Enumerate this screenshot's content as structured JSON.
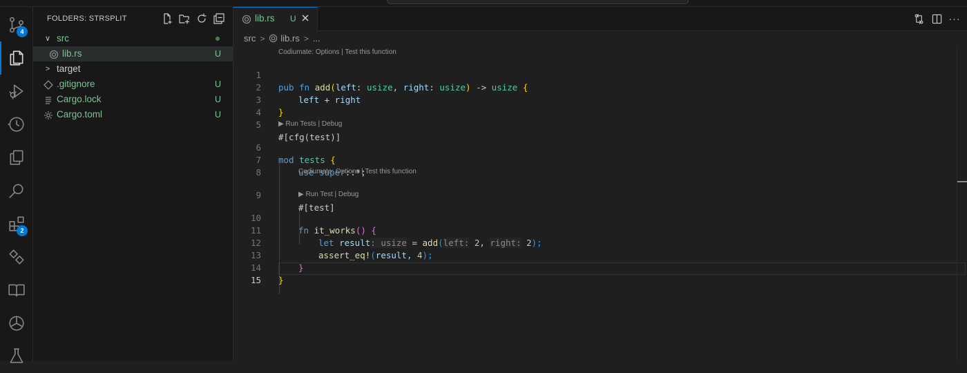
{
  "activity_bar": {
    "items": [
      {
        "name": "source-control",
        "badge": "4"
      },
      {
        "name": "explorer",
        "active": true
      },
      {
        "name": "run-debug"
      },
      {
        "name": "timeline"
      },
      {
        "name": "copy"
      },
      {
        "name": "search"
      },
      {
        "name": "extensions",
        "badge": "2"
      },
      {
        "name": "remote"
      },
      {
        "name": "book"
      },
      {
        "name": "chatgpt"
      },
      {
        "name": "testing"
      }
    ]
  },
  "sidebar": {
    "title": "FOLDERS: STRSPLIT",
    "tree": [
      {
        "label": "src",
        "type": "folder",
        "expanded": true,
        "status": "dot"
      },
      {
        "label": "lib.rs",
        "type": "file",
        "status": "U",
        "selected": true
      },
      {
        "label": "target",
        "type": "folder",
        "expanded": false,
        "status": ""
      },
      {
        "label": ".gitignore",
        "type": "file",
        "status": "U"
      },
      {
        "label": "Cargo.lock",
        "type": "file",
        "status": "U"
      },
      {
        "label": "Cargo.toml",
        "type": "file",
        "status": "U"
      }
    ]
  },
  "tabs": [
    {
      "label": "lib.rs",
      "status": "U",
      "active": true
    }
  ],
  "breadcrumb": {
    "parts": [
      "src",
      "lib.rs",
      "..."
    ]
  },
  "editor": {
    "lines": [
      "1",
      "2",
      "3",
      "4",
      "5",
      "6",
      "7",
      "8",
      "9",
      "10",
      "11",
      "12",
      "13",
      "14",
      "15"
    ],
    "lenses": {
      "add": "Codiumate: Options | Test this function",
      "tests": "▶ Run Tests | Debug",
      "it_works_codium": "Codiumate: Options | Test this function",
      "it_works_run": "▶ Run Test | Debug"
    },
    "code": {
      "l1": [
        "pub",
        "fn",
        "add",
        "(",
        "left",
        ": ",
        "usize",
        ", ",
        "right",
        ": ",
        "usize",
        ")",
        " -> ",
        "usize",
        " {"
      ],
      "l2": "left + right",
      "l3": "}",
      "l5": "#[cfg(test)]",
      "l6": [
        "mod",
        "tests",
        "{"
      ],
      "l7": [
        "use",
        "super",
        "::*;"
      ],
      "l9": "#[test]",
      "l10": [
        "fn",
        "it_works",
        "()",
        "{"
      ],
      "l11": [
        "let",
        "result",
        ": usize",
        " = ",
        "add",
        "(",
        "left:",
        "2",
        ", ",
        "right:",
        "2",
        ");"
      ],
      "l12": [
        "assert_eq!",
        "(",
        "result, ",
        "4",
        ");"
      ],
      "l13": "}",
      "l14": "}"
    }
  }
}
